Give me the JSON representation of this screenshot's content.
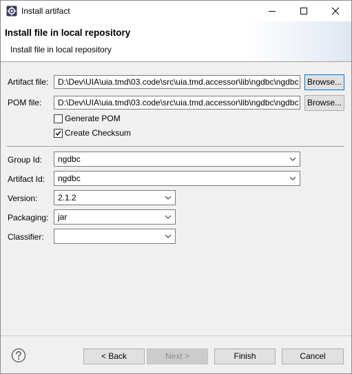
{
  "window": {
    "title": "Install artifact",
    "icon": "gear-icon"
  },
  "banner": {
    "title": "Install file in local repository",
    "description": "Install file in local repository"
  },
  "artifact_file": {
    "label": "Artifact file:",
    "value": "D:\\Dev\\UIA\\uia.tmd\\03.code\\src\\uia.tmd.accessor\\lib\\ngdbc\\ngdbc",
    "browse_label": "Browse..."
  },
  "pom_file": {
    "label": "POM file:",
    "value": "D:\\Dev\\UIA\\uia.tmd\\03.code\\src\\uia.tmd.accessor\\lib\\ngdbc\\ngdbc",
    "browse_label": "Browse..."
  },
  "options": {
    "generate_pom": {
      "label": "Generate POM",
      "checked": false
    },
    "create_checksum": {
      "label": "Create Checksum",
      "checked": true
    }
  },
  "fields": {
    "group_id": {
      "label": "Group Id:",
      "value": "ngdbc"
    },
    "artifact_id": {
      "label": "Artifact Id:",
      "value": "ngdbc"
    },
    "version": {
      "label": "Version:",
      "value": "2.1.2"
    },
    "packaging": {
      "label": "Packaging:",
      "value": "jar"
    },
    "classifier": {
      "label": "Classifier:",
      "value": ""
    }
  },
  "buttons": {
    "back": "< Back",
    "next": "Next >",
    "finish": "Finish",
    "cancel": "Cancel"
  },
  "colors": {
    "accent": "#0078d7",
    "dialog_bg": "#f0f0f0"
  }
}
